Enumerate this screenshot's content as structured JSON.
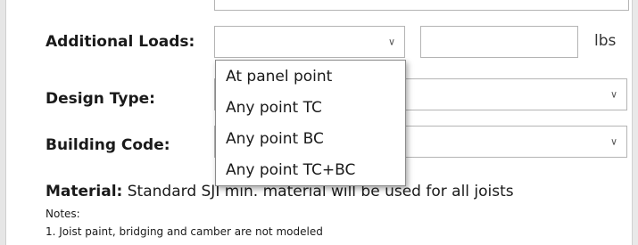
{
  "form": {
    "additional_loads": {
      "label": "Additional Loads:",
      "selected": "",
      "options": [
        "At panel point",
        "Any point TC",
        "Any point BC",
        "Any point TC+BC"
      ],
      "amount_value": "",
      "unit": "lbs"
    },
    "design_type": {
      "label": "Design Type:",
      "selected": ""
    },
    "building_code": {
      "label": "Building Code:",
      "selected": ""
    },
    "material": {
      "label": "Material:",
      "text": "Standard SJI min. material will be used for all joists"
    },
    "notes": {
      "title": "Notes:",
      "items": [
        "1. Joist paint, bridging and camber are not modeled"
      ]
    }
  }
}
